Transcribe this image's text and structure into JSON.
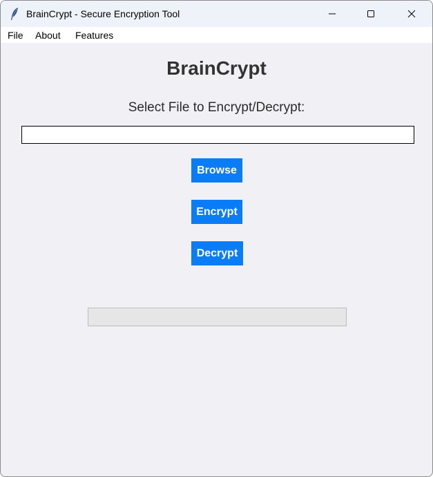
{
  "window": {
    "title": "BrainCrypt - Secure Encryption Tool",
    "icon": "feather-icon"
  },
  "menu": {
    "file": "File",
    "about": "About",
    "features": "Features"
  },
  "main": {
    "heading": "BrainCrypt",
    "select_label": "Select File to Encrypt/Decrypt:",
    "file_path_value": "",
    "browse_label": "Browse",
    "encrypt_label": "Encrypt",
    "decrypt_label": "Decrypt",
    "progress": 0
  },
  "colors": {
    "button_bg": "#0a7cf5",
    "button_text": "#ffffff",
    "window_bg": "#f0f0f5",
    "heading_text": "#333333"
  }
}
